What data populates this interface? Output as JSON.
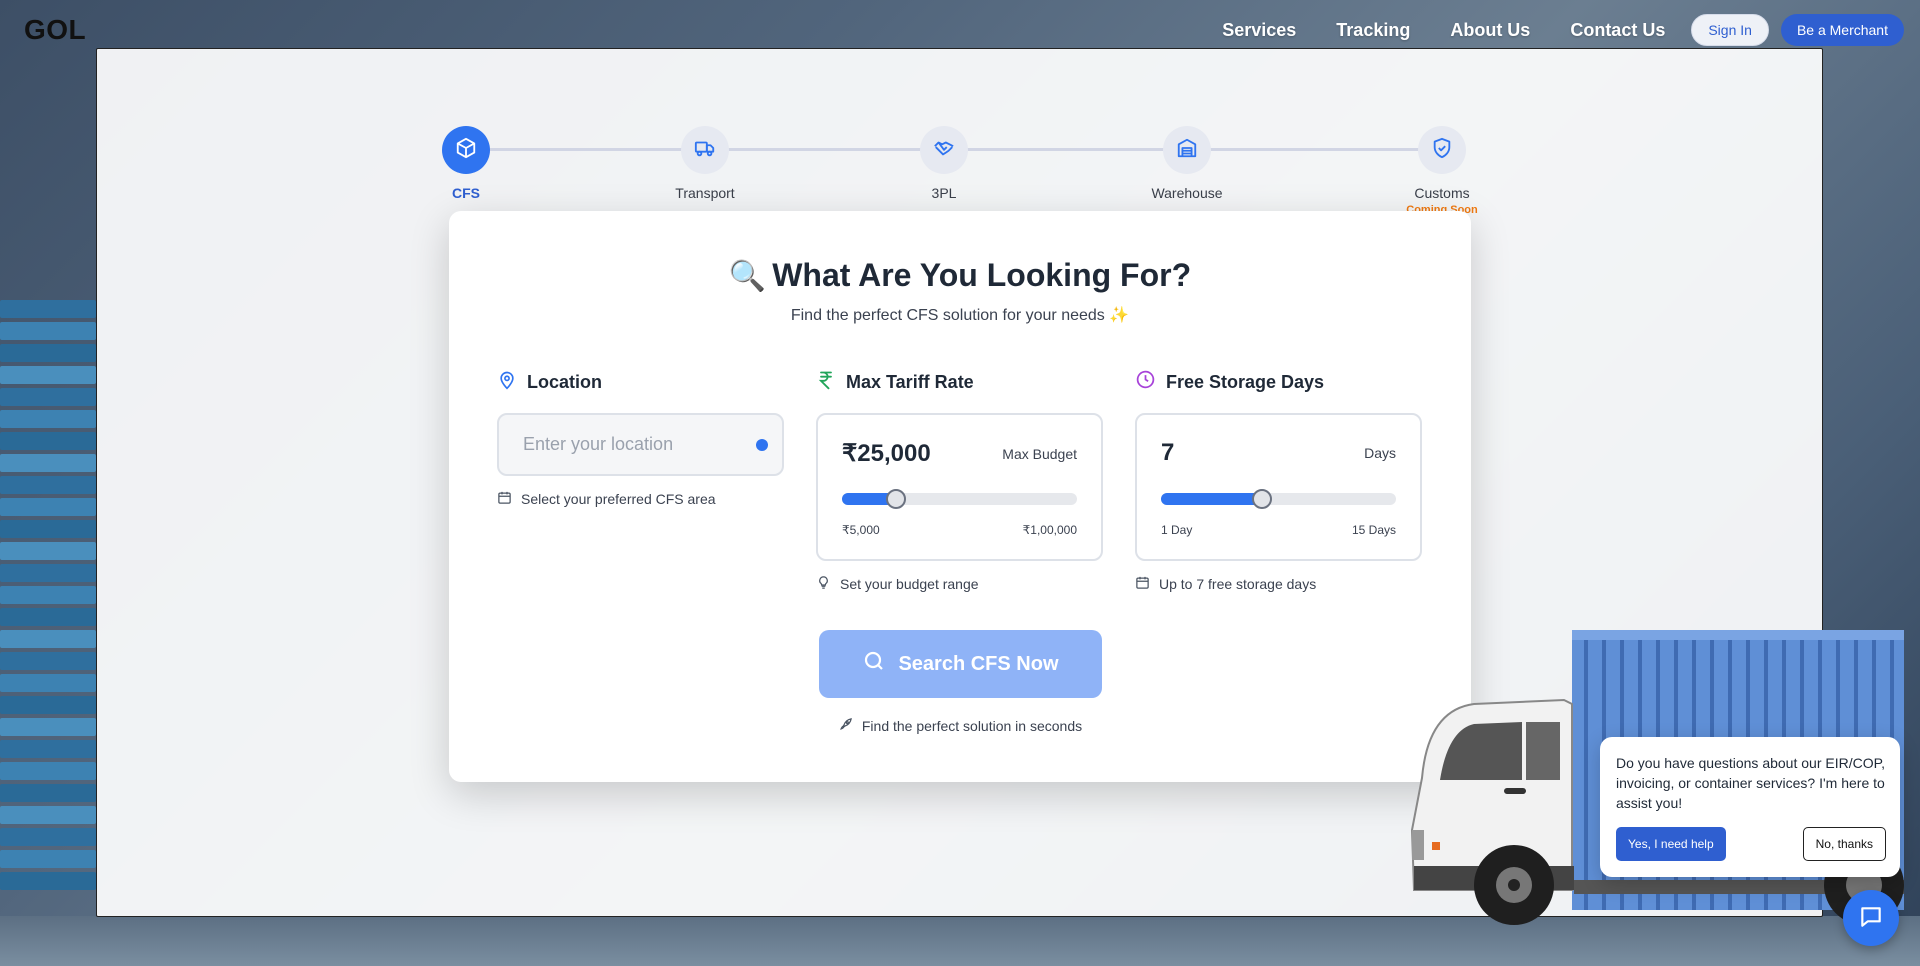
{
  "header": {
    "logo": "GOL",
    "nav": [
      "Services",
      "Tracking",
      "About Us",
      "Contact Us"
    ],
    "sign_in": "Sign In",
    "merchant": "Be a Merchant"
  },
  "stepper": {
    "steps": [
      {
        "label": "CFS",
        "icon": "box-icon",
        "active": true
      },
      {
        "label": "Transport",
        "icon": "truck-icon",
        "active": false
      },
      {
        "label": "3PL",
        "icon": "handshake-icon",
        "active": false
      },
      {
        "label": "Warehouse",
        "icon": "warehouse-icon",
        "active": false
      },
      {
        "label": "Customs",
        "icon": "shield-check-icon",
        "active": false,
        "badge": "Coming Soon"
      }
    ]
  },
  "card": {
    "title_emoji": "🔍",
    "title": "What Are You Looking For?",
    "subtitle": "Find the perfect CFS solution for your needs ✨",
    "location": {
      "label": "Location",
      "placeholder": "Enter your location",
      "hint": "Select your preferred CFS area"
    },
    "tariff": {
      "label": "Max Tariff Rate",
      "value": "₹25,000",
      "unit": "Max Budget",
      "min": "₹5,000",
      "max": "₹1,00,000",
      "fraction": 0.23,
      "hint": "Set your budget range"
    },
    "storage": {
      "label": "Free Storage Days",
      "value": "7",
      "unit": "Days",
      "min": "1 Day",
      "max": "15 Days",
      "fraction": 0.43,
      "hint": "Up to 7 free storage days"
    },
    "search_button": "Search CFS Now",
    "search_hint": "Find the perfect solution in seconds"
  },
  "chat": {
    "message": "Do you have questions about our EIR/COP, invoicing, or container services? I'm here to assist you!",
    "yes": "Yes, I need help",
    "no": "No, thanks"
  },
  "colors": {
    "accent": "#2f74f0",
    "brand": "#2f5fd0",
    "coming_soon": "#f07a12",
    "tariff_icon": "#22a55a",
    "storage_icon": "#a742d9",
    "location_icon": "#2f74f0"
  }
}
